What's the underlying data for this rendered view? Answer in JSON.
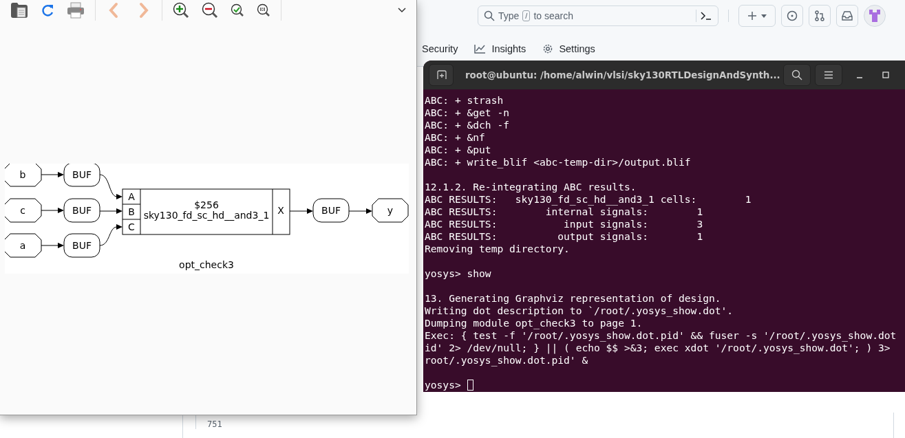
{
  "github": {
    "search": {
      "hint_before": "Type",
      "hint_key": "/",
      "hint_after": "to search"
    },
    "nav": [
      {
        "label": "Security",
        "kind": "plain"
      },
      {
        "label": "Insights",
        "kind": "graph"
      },
      {
        "label": "Settings",
        "kind": "gear"
      }
    ],
    "line_numbers": [
      "751"
    ]
  },
  "xdot": {
    "graph": {
      "inputs": [
        "b",
        "c",
        "a"
      ],
      "buffers": [
        "BUF",
        "BUF",
        "BUF"
      ],
      "cell": {
        "id": "$256",
        "type": "sky130_fd_sc_hd__and3_1",
        "ports": [
          "A",
          "B",
          "C"
        ],
        "output": "X"
      },
      "out_buffer": "BUF",
      "output": "y",
      "module": "opt_check3"
    }
  },
  "terminal": {
    "title": "root@ubuntu: /home/alwin/vlsi/sky130RTLDesignAndSynth...",
    "blocks": [
      [
        "ABC: + strash",
        "ABC: + &get -n",
        "ABC: + &dch -f",
        "ABC: + &nf",
        "ABC: + &put",
        "ABC: + write_blif <abc-temp-dir>/output.blif"
      ],
      [
        "12.1.2. Re-integrating ABC results.",
        "ABC RESULTS:   sky130_fd_sc_hd__and3_1 cells:        1",
        "ABC RESULTS:        internal signals:        1",
        "ABC RESULTS:           input signals:        3",
        "ABC RESULTS:          output signals:        1",
        "Removing temp directory."
      ],
      [
        "yosys> show"
      ],
      [
        "13. Generating Graphviz representation of design.",
        "Writing dot description to `/root/.yosys_show.dot'.",
        "Dumping module opt_check3 to page 1.",
        "Exec: { test -f '/root/.yosys_show.dot.pid' && fuser -s '/root/.yosys_show.dot",
        "id' 2> /dev/null; } || ( echo $$ >&3; exec xdot '/root/.yosys_show.dot'; ) 3>",
        "root/.yosys_show.dot.pid' &"
      ]
    ],
    "prompt": "yosys>"
  }
}
